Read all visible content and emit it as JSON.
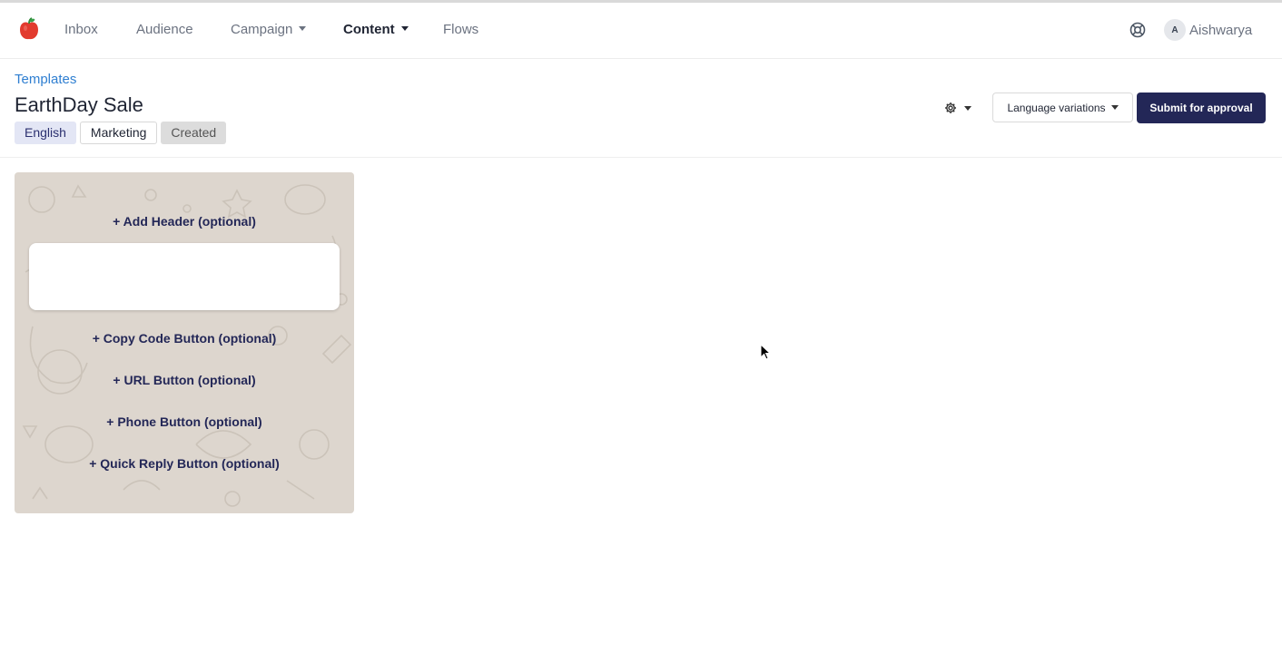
{
  "nav": {
    "items": [
      {
        "label": "Inbox",
        "dropdown": false,
        "active": false
      },
      {
        "label": "Audience",
        "dropdown": false,
        "active": false
      },
      {
        "label": "Campaign",
        "dropdown": true,
        "active": false
      },
      {
        "label": "Content",
        "dropdown": true,
        "active": true
      },
      {
        "label": "Flows",
        "dropdown": false,
        "active": false
      }
    ],
    "user": {
      "initial": "A",
      "name": "Aishwarya"
    },
    "icons": {
      "logo": "apple-logo",
      "support": "lifebuoy-icon"
    }
  },
  "header": {
    "breadcrumb": "Templates",
    "title": "EarthDay Sale",
    "tags": {
      "language": "English",
      "category": "Marketing",
      "status": "Created"
    },
    "language_variations_label": "Language variations",
    "submit_label": "Submit for approval"
  },
  "editor": {
    "add_header": "+ Add Header (optional)",
    "copy_code_button": "+ Copy Code Button (optional)",
    "url_button": "+ URL Button (optional)",
    "phone_button": "+ Phone Button (optional)",
    "quick_reply_button": "+ Quick Reply Button (optional)"
  },
  "colors": {
    "accent": "#232757",
    "link": "#2f7fd1",
    "editor_background": "#ddd6ce"
  }
}
